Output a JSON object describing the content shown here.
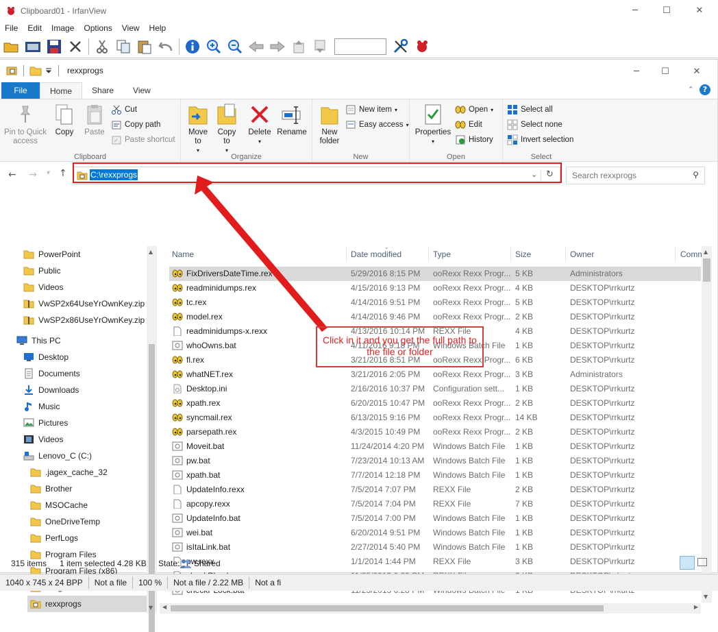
{
  "irfanview": {
    "title": "Clipboard01 - IrfanView",
    "menu": [
      "File",
      "Edit",
      "Image",
      "Options",
      "View",
      "Help"
    ],
    "status": [
      "1040 x 745 x 24 BPP",
      "Not a file",
      "100 %",
      "Not a file / 2.22 MB",
      "Not a fi"
    ]
  },
  "explorer": {
    "title": "rexxprogs",
    "tabs": {
      "file": "File",
      "home": "Home",
      "share": "Share",
      "view": "View"
    },
    "ribbon": {
      "clipboard": {
        "label": "Clipboard",
        "pin": "Pin to Quick access",
        "copy": "Copy",
        "paste": "Paste",
        "cut": "Cut",
        "copy_path": "Copy path",
        "paste_shortcut": "Paste shortcut"
      },
      "organize": {
        "label": "Organize",
        "move_to": "Move to",
        "copy_to": "Copy to",
        "delete": "Delete",
        "rename": "Rename"
      },
      "new": {
        "label": "New",
        "new_folder": "New folder",
        "new_item": "New item",
        "easy_access": "Easy access"
      },
      "open": {
        "label": "Open",
        "properties": "Properties",
        "open": "Open",
        "edit": "Edit",
        "history": "History"
      },
      "select": {
        "label": "Select",
        "select_all": "Select all",
        "select_none": "Select none",
        "invert": "Invert selection"
      }
    },
    "address": "C:\\rexxprogs",
    "search_placeholder": "Search rexxprogs",
    "tree": [
      {
        "label": "PowerPoint",
        "icon": "folder-icon"
      },
      {
        "label": "Public",
        "icon": "folder-icon"
      },
      {
        "label": "Videos",
        "icon": "folder-icon"
      },
      {
        "label": "VwSP2x64UseYrOwnKey.zip",
        "icon": "zip-folder-icon"
      },
      {
        "label": "VwSP2x86UseYrOwnKey.zip",
        "icon": "zip-folder-icon"
      },
      {
        "label": "This PC",
        "icon": "computer-icon"
      },
      {
        "label": "Desktop",
        "icon": "desktop-icon"
      },
      {
        "label": "Documents",
        "icon": "documents-icon"
      },
      {
        "label": "Downloads",
        "icon": "downloads-icon"
      },
      {
        "label": "Music",
        "icon": "music-icon"
      },
      {
        "label": "Pictures",
        "icon": "pictures-icon"
      },
      {
        "label": "Videos",
        "icon": "videos-icon"
      },
      {
        "label": "Lenovo_C (C:)",
        "icon": "drive-icon"
      },
      {
        "label": ".jagex_cache_32",
        "icon": "folder-icon"
      },
      {
        "label": "Brother",
        "icon": "folder-icon"
      },
      {
        "label": "MSOCache",
        "icon": "folder-icon"
      },
      {
        "label": "OneDriveTemp",
        "icon": "folder-icon"
      },
      {
        "label": "PerfLogs",
        "icon": "folder-icon"
      },
      {
        "label": "Program Files",
        "icon": "folder-icon"
      },
      {
        "label": "Program Files (x86)",
        "icon": "folder-icon"
      },
      {
        "label": "ProgramData",
        "icon": "folder-icon"
      },
      {
        "label": "rexxprogs",
        "icon": "shared-folder-icon"
      }
    ],
    "columns": {
      "name": "Name",
      "date": "Date modified",
      "type": "Type",
      "size": "Size",
      "owner": "Owner",
      "comments": "Comm"
    },
    "files": [
      {
        "name": "FixDriversDateTime.rex",
        "date": "5/29/2016 8:15 PM",
        "type": "ooRexx Rexx Progr...",
        "size": "5 KB",
        "owner": "Administrators",
        "icon": "rexx-icon"
      },
      {
        "name": "readminidumps.rex",
        "date": "4/15/2016 9:13 PM",
        "type": "ooRexx Rexx Progr...",
        "size": "4 KB",
        "owner": "DESKTOP\\rrkurtz",
        "icon": "rexx-icon"
      },
      {
        "name": "tc.rex",
        "date": "4/14/2016 9:51 PM",
        "type": "ooRexx Rexx Progr...",
        "size": "5 KB",
        "owner": "DESKTOP\\rrkurtz",
        "icon": "rexx-icon"
      },
      {
        "name": "model.rex",
        "date": "4/14/2016 9:46 PM",
        "type": "ooRexx Rexx Progr...",
        "size": "2 KB",
        "owner": "DESKTOP\\rrkurtz",
        "icon": "rexx-icon"
      },
      {
        "name": "readminidumps-x.rexx",
        "date": "4/13/2016 10:14 PM",
        "type": "REXX File",
        "size": "4 KB",
        "owner": "DESKTOP\\rrkurtz",
        "icon": "file-icon"
      },
      {
        "name": "whoOwns.bat",
        "date": "4/11/2016 9:18 PM",
        "type": "Windows Batch File",
        "size": "1 KB",
        "owner": "DESKTOP\\rrkurtz",
        "icon": "batch-icon"
      },
      {
        "name": "fl.rex",
        "date": "3/21/2016 8:51 PM",
        "type": "ooRexx Rexx Progr...",
        "size": "6 KB",
        "owner": "DESKTOP\\rrkurtz",
        "icon": "rexx-icon"
      },
      {
        "name": "whatNET.rex",
        "date": "3/21/2016 2:05 PM",
        "type": "ooRexx Rexx Progr...",
        "size": "3 KB",
        "owner": "Administrators",
        "icon": "rexx-icon"
      },
      {
        "name": "Desktop.ini",
        "date": "2/16/2016 10:37 PM",
        "type": "Configuration sett...",
        "size": "1 KB",
        "owner": "DESKTOP\\rrkurtz",
        "icon": "ini-icon"
      },
      {
        "name": "xpath.rex",
        "date": "6/20/2015 10:47 PM",
        "type": "ooRexx Rexx Progr...",
        "size": "2 KB",
        "owner": "DESKTOP\\rrkurtz",
        "icon": "rexx-icon"
      },
      {
        "name": "syncmail.rex",
        "date": "6/13/2015 9:16 PM",
        "type": "ooRexx Rexx Progr...",
        "size": "14 KB",
        "owner": "DESKTOP\\rrkurtz",
        "icon": "rexx-icon"
      },
      {
        "name": "parsepath.rex",
        "date": "4/3/2015 10:49 PM",
        "type": "ooRexx Rexx Progr...",
        "size": "2 KB",
        "owner": "DESKTOP\\rrkurtz",
        "icon": "rexx-icon"
      },
      {
        "name": "Moveit.bat",
        "date": "11/24/2014 4:20 PM",
        "type": "Windows Batch File",
        "size": "1 KB",
        "owner": "DESKTOP\\rrkurtz",
        "icon": "batch-icon"
      },
      {
        "name": "pw.bat",
        "date": "7/23/2014 10:13 AM",
        "type": "Windows Batch File",
        "size": "1 KB",
        "owner": "DESKTOP\\rrkurtz",
        "icon": "batch-icon"
      },
      {
        "name": "xpath.bat",
        "date": "7/7/2014 12:18 PM",
        "type": "Windows Batch File",
        "size": "1 KB",
        "owner": "DESKTOP\\rrkurtz",
        "icon": "batch-icon"
      },
      {
        "name": "UpdateInfo.rexx",
        "date": "7/5/2014 7:07 PM",
        "type": "REXX File",
        "size": "2 KB",
        "owner": "DESKTOP\\rrkurtz",
        "icon": "file-icon"
      },
      {
        "name": "apcopy.rexx",
        "date": "7/5/2014 7:04 PM",
        "type": "REXX File",
        "size": "7 KB",
        "owner": "DESKTOP\\rrkurtz",
        "icon": "file-icon"
      },
      {
        "name": "UpdateInfo.bat",
        "date": "7/5/2014 7:00 PM",
        "type": "Windows Batch File",
        "size": "1 KB",
        "owner": "DESKTOP\\rrkurtz",
        "icon": "batch-icon"
      },
      {
        "name": "wei.bat",
        "date": "6/20/2014 9:51 PM",
        "type": "Windows Batch File",
        "size": "1 KB",
        "owner": "DESKTOP\\rrkurtz",
        "icon": "batch-icon"
      },
      {
        "name": "isItaLink.bat",
        "date": "2/27/2014 5:40 PM",
        "type": "Windows Batch File",
        "size": "1 KB",
        "owner": "DESKTOP\\rrkurtz",
        "icon": "batch-icon"
      },
      {
        "name": "pw.rexx",
        "date": "1/1/2014 1:44 PM",
        "type": "REXX File",
        "size": "3 KB",
        "owner": "DESKTOP\\rrkurtz",
        "icon": "file-icon"
      },
      {
        "name": "checkPLock.rexx",
        "date": "11/25/2013 6:29 PM",
        "type": "REXX File",
        "size": "2 KB",
        "owner": "DESKTOP\\rrkurtz",
        "icon": "file-icon"
      },
      {
        "name": "checkPLock.bat",
        "date": "11/25/2013 6:28 PM",
        "type": "Windows Batch File",
        "size": "1 KB",
        "owner": "DESKTOP\\rrkurtz",
        "icon": "batch-icon"
      }
    ],
    "status": {
      "items": "315 items",
      "selected": "1 item selected  4.28 KB",
      "state_label": "State:",
      "state": "Shared"
    }
  },
  "annotation": {
    "text": "Click in it and you get the full path to the file or folder",
    "color": "#e22020"
  }
}
